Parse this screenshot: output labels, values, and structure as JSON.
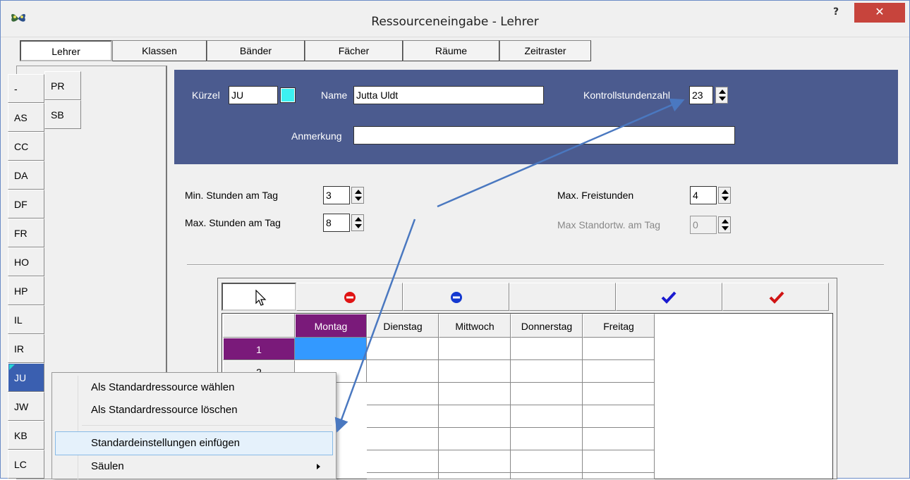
{
  "window": {
    "title": "Ressourceneingabe - Lehrer",
    "help_label": "?",
    "close_label": "✕",
    "app_icon": "butterfly-icon"
  },
  "tabs": [
    {
      "label": "Lehrer",
      "active": true
    },
    {
      "label": "Klassen",
      "active": false
    },
    {
      "label": "Bänder",
      "active": false
    },
    {
      "label": "Fächer",
      "active": false
    },
    {
      "label": "Räume",
      "active": false
    },
    {
      "label": "Zeitraster",
      "active": false
    }
  ],
  "teacher_list": {
    "column1": [
      "-",
      "AS",
      "CC",
      "DA",
      "DF",
      "FR",
      "HO",
      "HP",
      "IL",
      "IR",
      "JU",
      "JW",
      "KB",
      "LC"
    ],
    "column2": [
      "PR",
      "SB"
    ],
    "selected": "JU"
  },
  "details": {
    "kuerzel_label": "Kürzel",
    "kuerzel_value": "JU",
    "name_label": "Name",
    "name_value": "Jutta Uldt",
    "kontroll_label": "Kontrollstundenzahl",
    "kontroll_value": "23",
    "anmerkung_label": "Anmerkung",
    "anmerkung_value": "",
    "swatch_color": "#3cf1f1"
  },
  "options": {
    "min_label": "Min. Stunden am Tag",
    "min_value": "3",
    "max_label": "Max. Stunden am Tag",
    "max_value": "8",
    "frei_label": "Max. Freistunden",
    "frei_value": "4",
    "standort_label": "Max Standortw. am Tag",
    "standort_value": "0"
  },
  "grid_tools": [
    {
      "icon": "cursor-icon"
    },
    {
      "icon": "red-minus-icon"
    },
    {
      "icon": "blue-minus-icon"
    },
    {
      "icon": "blank"
    },
    {
      "icon": "blue-check-icon"
    },
    {
      "icon": "red-check-icon"
    }
  ],
  "grid": {
    "days": [
      "Montag",
      "Dienstag",
      "Mittwoch",
      "Donnerstag",
      "Freitag"
    ],
    "rows": [
      "1",
      "2"
    ],
    "selected_day": "Montag",
    "selected_row": "1"
  },
  "context_menu": {
    "items": [
      {
        "label": "Als Standardressource wählen"
      },
      {
        "label": "Als Standardressource löschen"
      },
      {
        "label": "Standardeinstellungen einfügen",
        "highlighted": true
      },
      {
        "label": "Säulen",
        "submenu": true
      }
    ]
  },
  "colors": {
    "header_panel": "#4b5b8f",
    "selected_list": "#3a5fb0",
    "selected_day": "#7a1a7a",
    "selected_cell": "#3399ff",
    "close_button": "#c7443c",
    "annotation_arrow": "#4a78c0"
  }
}
